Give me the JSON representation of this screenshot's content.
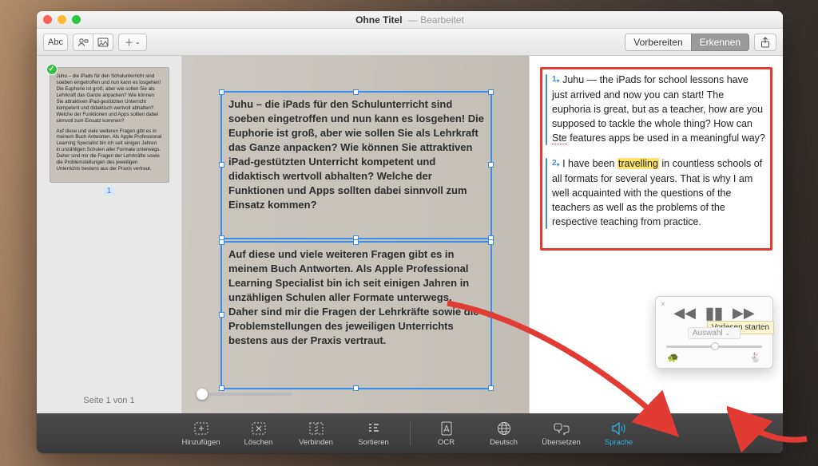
{
  "window": {
    "title_main": "Ohne Titel",
    "title_sub": "— Bearbeitet"
  },
  "toolbar": {
    "abc_label": "Abc",
    "prepare_label": "Vorbereiten",
    "recognize_label": "Erkennen"
  },
  "sidebar": {
    "page_indicator": "Seite 1 von 1",
    "thumb_number": "1",
    "thumb_para1": "Juhu – die iPads für den Schulunterricht sind soeben eingetroffen und nun kann es losgehen! Die Euphorie ist groß, aber wie sollen Sie als Lehrkraft das Ganze anpacken? Wie können Sie attraktiven iPad-gestützten Unterricht kompetent und didaktisch wertvoll abhalten? Welche der Funktionen und Apps sollten dabei sinnvoll zum Einsatz kommen?",
    "thumb_para2": "Auf diese und viele weiteren Fragen gibt es in meinem Buch Antworten. Als Apple Professional Learning Specialist bin ich seit einigen Jahren in unzähligen Schulen aller Formate unterwegs. Daher sind mir die Fragen der Lehrkräfte sowie die Problemstellungen des jeweiligen Unterrichts bestens aus der Praxis vertraut."
  },
  "canvas": {
    "box1": "Juhu – die iPads für den Schulunterricht sind soeben eingetroffen und nun kann es losgehen! Die Euphorie ist groß, aber wie sollen Sie als Lehrkraft das Ganze anpacken? Wie können Sie attraktiven iPad-gestützten Unterricht kompetent und didaktisch wertvoll abhalten? Welche der Funktionen und Apps sollten dabei sinnvoll zum Einsatz kommen?",
    "box2": "Auf diese und viele weiteren Fragen gibt es in meinem Buch Antworten. Als Apple Professional Learning Specialist bin ich seit einigen Jahren in unzähligen Schulen aller Formate unterwegs. Daher sind mir die Fragen der Lehrkräfte sowie die Problemstellungen des jeweiligen Unterrichts bestens aus der Praxis vertraut."
  },
  "translation": {
    "items": [
      {
        "num": "1",
        "pre": "Juhu — the iPads for school lessons have just arrived and now you can start! The euphoria is great, but as a teacher, how are you supposed to tackle the whole thing? How can ",
        "squiggle": "Ste",
        "post": " features apps be used in a meaningful way?"
      },
      {
        "num": "2",
        "pre": "I have been ",
        "highlight": "travelling",
        "post": " in countless schools of all formats for several years. That is why I am well acquainted with the questions of the teachers as well as the problems of the respective teaching from practice."
      }
    ]
  },
  "speak": {
    "tooltip": "Vorlesen starten",
    "select_label": "Auswahl"
  },
  "bottombar": {
    "add": "Hinzufügen",
    "delete": "Löschen",
    "connect": "Verbinden",
    "sort": "Sortieren",
    "ocr": "OCR",
    "german": "Deutsch",
    "translate": "Übersetzen",
    "speech": "Sprache"
  }
}
